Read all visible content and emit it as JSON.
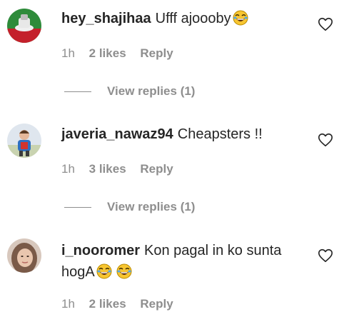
{
  "comments": [
    {
      "username": "hey_shajihaa",
      "text": "Ufff ajoooby",
      "emojis": [
        "joy-emoji"
      ],
      "time": "1h",
      "likes": "2 likes",
      "reply_label": "Reply",
      "view_replies": "View replies (1)",
      "avatar": "green-red-avatar"
    },
    {
      "username": "javeria_nawaz94",
      "text": "Cheapsters !!",
      "emojis": [],
      "time": "1h",
      "likes": "3 likes",
      "reply_label": "Reply",
      "view_replies": "View replies (1)",
      "avatar": "child-avatar"
    },
    {
      "username": "i_nooromer",
      "text": "Kon pagal in ko sunta hogA",
      "emojis": [
        "joy-emoji",
        "joy-emoji"
      ],
      "time": "1h",
      "likes": "2 likes",
      "reply_label": "Reply",
      "avatar": "woman-avatar"
    }
  ],
  "icons": {
    "like": "heart-outline-icon"
  },
  "colors": {
    "text": "#262626",
    "secondary": "#8e8e8e",
    "background": "#ffffff"
  }
}
